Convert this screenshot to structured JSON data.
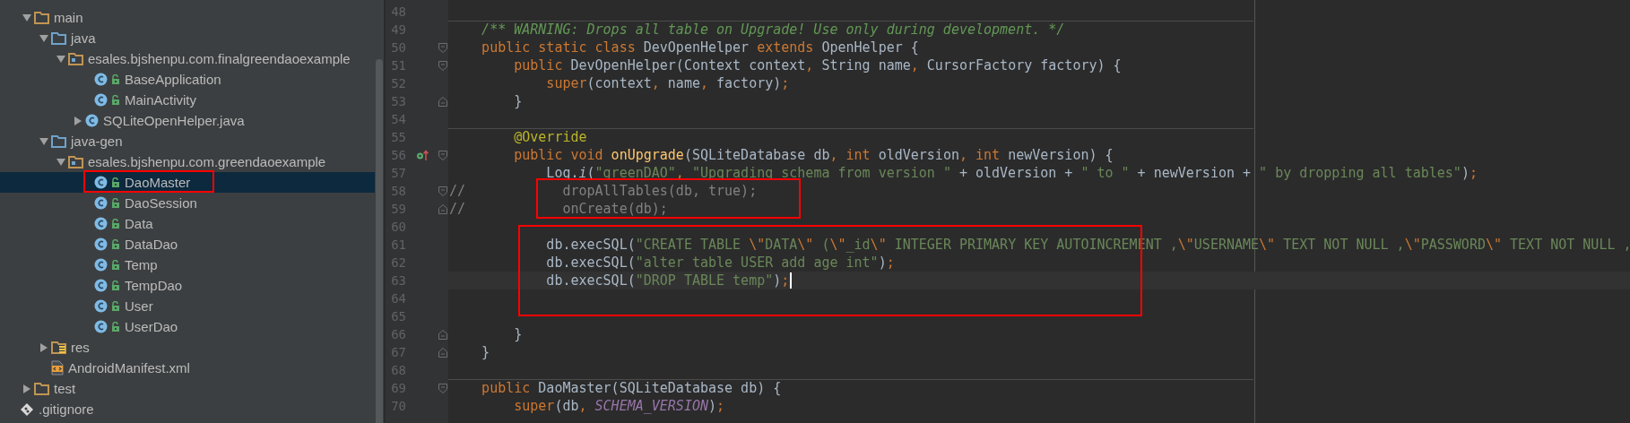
{
  "project_tree": [
    {
      "label": "main",
      "kind": "folder",
      "expanded": true,
      "selected": false,
      "children": [
        {
          "label": "java",
          "kind": "source-folder",
          "expanded": true,
          "selected": false,
          "children": [
            {
              "label": "esales.bjshenpu.com.finalgreendaoexample",
              "kind": "package",
              "expanded": true,
              "selected": false,
              "children": [
                {
                  "label": "BaseApplication",
                  "kind": "class",
                  "selected": false
                },
                {
                  "label": "MainActivity",
                  "kind": "class",
                  "selected": false
                },
                {
                  "label": "SQLiteOpenHelper.java",
                  "kind": "java-file",
                  "expanded": false,
                  "selected": false
                }
              ]
            }
          ]
        },
        {
          "label": "java-gen",
          "kind": "source-folder",
          "expanded": true,
          "selected": false,
          "children": [
            {
              "label": "esales.bjshenpu.com.greendaoexample",
              "kind": "package",
              "expanded": true,
              "selected": false,
              "children": [
                {
                  "label": "DaoMaster",
                  "kind": "class",
                  "selected": true
                },
                {
                  "label": "DaoSession",
                  "kind": "class",
                  "selected": false
                },
                {
                  "label": "Data",
                  "kind": "class",
                  "selected": false
                },
                {
                  "label": "DataDao",
                  "kind": "class",
                  "selected": false
                },
                {
                  "label": "Temp",
                  "kind": "class",
                  "selected": false
                },
                {
                  "label": "TempDao",
                  "kind": "class",
                  "selected": false
                },
                {
                  "label": "User",
                  "kind": "class",
                  "selected": false
                },
                {
                  "label": "UserDao",
                  "kind": "class",
                  "selected": false
                }
              ]
            }
          ]
        },
        {
          "label": "res",
          "kind": "res-folder",
          "expanded": false,
          "selected": false
        },
        {
          "label": "AndroidManifest.xml",
          "kind": "manifest",
          "selected": false
        }
      ]
    },
    {
      "label": "test",
      "kind": "folder",
      "expanded": false,
      "selected": false
    },
    {
      "label": ".gitignore",
      "kind": "git-file",
      "selected": false
    }
  ],
  "editor": {
    "lines": [
      {
        "number": "48",
        "fold_start": false,
        "fold_end": false,
        "override": false,
        "separator_above": false,
        "current": false
      },
      {
        "number": "49",
        "fold_start": false,
        "fold_end": false,
        "override": false,
        "separator_above": true,
        "current": false,
        "tokens": [
          {
            "kind": "doc",
            "text": "    /** WARNING: Drops all table on Upgrade! Use only during development. */"
          }
        ]
      },
      {
        "number": "50",
        "fold_start": true,
        "fold_end": false,
        "override": false,
        "separator_above": false,
        "current": false,
        "tokens": [
          {
            "kind": "keyword",
            "text": "    public static class "
          },
          {
            "kind": "plain",
            "text": "DevOpenHelper "
          },
          {
            "kind": "keyword",
            "text": "extends "
          },
          {
            "kind": "plain",
            "text": "OpenHelper {"
          }
        ]
      },
      {
        "number": "51",
        "fold_start": true,
        "fold_end": false,
        "override": false,
        "separator_above": false,
        "current": false,
        "tokens": [
          {
            "kind": "keyword",
            "text": "        public "
          },
          {
            "kind": "plain",
            "text": "DevOpenHelper(Context context"
          },
          {
            "kind": "punct",
            "text": ", "
          },
          {
            "kind": "plain",
            "text": "String name"
          },
          {
            "kind": "punct",
            "text": ", "
          },
          {
            "kind": "plain",
            "text": "CursorFactory factory) {"
          }
        ]
      },
      {
        "number": "52",
        "fold_start": false,
        "fold_end": false,
        "override": false,
        "separator_above": false,
        "current": false,
        "tokens": [
          {
            "kind": "keyword",
            "text": "            super"
          },
          {
            "kind": "plain",
            "text": "(context"
          },
          {
            "kind": "punct",
            "text": ", "
          },
          {
            "kind": "plain",
            "text": "name"
          },
          {
            "kind": "punct",
            "text": ", "
          },
          {
            "kind": "plain",
            "text": "factory)"
          },
          {
            "kind": "punct",
            "text": ";"
          }
        ]
      },
      {
        "number": "53",
        "fold_start": false,
        "fold_end": true,
        "override": false,
        "separator_above": false,
        "current": false,
        "tokens": [
          {
            "kind": "plain",
            "text": "        }"
          }
        ]
      },
      {
        "number": "54",
        "fold_start": false,
        "fold_end": false,
        "override": false,
        "separator_above": false,
        "current": false
      },
      {
        "number": "55",
        "fold_start": false,
        "fold_end": false,
        "override": false,
        "separator_above": true,
        "current": false,
        "tokens": [
          {
            "kind": "annotation",
            "text": "        @Override"
          }
        ]
      },
      {
        "number": "56",
        "fold_start": true,
        "fold_end": false,
        "override": true,
        "separator_above": false,
        "current": false,
        "tokens": [
          {
            "kind": "keyword",
            "text": "        public void "
          },
          {
            "kind": "method",
            "text": "onUpgrade"
          },
          {
            "kind": "plain",
            "text": "(SQLiteDatabase db"
          },
          {
            "kind": "punct",
            "text": ", "
          },
          {
            "kind": "keyword",
            "text": "int "
          },
          {
            "kind": "plain",
            "text": "oldVersion"
          },
          {
            "kind": "punct",
            "text": ", "
          },
          {
            "kind": "keyword",
            "text": "int "
          },
          {
            "kind": "plain",
            "text": "newVersion) {"
          }
        ]
      },
      {
        "number": "57",
        "fold_start": false,
        "fold_end": false,
        "override": false,
        "separator_above": false,
        "current": false,
        "tokens": [
          {
            "kind": "plain",
            "text": "            Log."
          },
          {
            "kind": "static",
            "text": "i"
          },
          {
            "kind": "plain",
            "text": "("
          },
          {
            "kind": "string",
            "text": "\"greenDAO\""
          },
          {
            "kind": "punct",
            "text": ", "
          },
          {
            "kind": "string",
            "text": "\"Upgrading schema from version \""
          },
          {
            "kind": "plain",
            "text": " + oldVersion + "
          },
          {
            "kind": "string",
            "text": "\" to \""
          },
          {
            "kind": "plain",
            "text": " + newVersion + "
          },
          {
            "kind": "string",
            "text": "\" by dropping all tables\""
          },
          {
            "kind": "plain",
            "text": ")"
          },
          {
            "kind": "punct",
            "text": ";"
          }
        ]
      },
      {
        "number": "58",
        "fold_start": true,
        "fold_end": false,
        "override": false,
        "separator_above": false,
        "current": false,
        "tokens": [
          {
            "kind": "commented",
            "text": "//            dropAllTables(db, true);"
          }
        ]
      },
      {
        "number": "59",
        "fold_start": false,
        "fold_end": true,
        "override": false,
        "separator_above": false,
        "current": false,
        "tokens": [
          {
            "kind": "commented",
            "text": "//            onCreate(db);"
          }
        ]
      },
      {
        "number": "60",
        "fold_start": false,
        "fold_end": false,
        "override": false,
        "separator_above": false,
        "current": false
      },
      {
        "number": "61",
        "fold_start": false,
        "fold_end": false,
        "override": false,
        "separator_above": false,
        "current": false,
        "tokens": [
          {
            "kind": "plain",
            "text": "            db.execSQL("
          },
          {
            "kind": "string",
            "text": "\"CREATE TABLE "
          },
          {
            "kind": "escape",
            "text": "\\\""
          },
          {
            "kind": "string",
            "text": "DATA"
          },
          {
            "kind": "escape",
            "text": "\\\""
          },
          {
            "kind": "string",
            "text": " ("
          },
          {
            "kind": "escape",
            "text": "\\\""
          },
          {
            "kind": "string",
            "text": "_id"
          },
          {
            "kind": "escape",
            "text": "\\\""
          },
          {
            "kind": "string",
            "text": " INTEGER PRIMARY KEY AUTOINCREMENT ,"
          },
          {
            "kind": "escape",
            "text": "\\\""
          },
          {
            "kind": "string",
            "text": "USERNAME"
          },
          {
            "kind": "escape",
            "text": "\\\""
          },
          {
            "kind": "string",
            "text": " TEXT NOT NULL ,"
          },
          {
            "kind": "escape",
            "text": "\\\""
          },
          {
            "kind": "string",
            "text": "PASSWORD"
          },
          {
            "kind": "escape",
            "text": "\\\""
          },
          {
            "kind": "string",
            "text": " TEXT NOT NULL ,"
          }
        ]
      },
      {
        "number": "62",
        "fold_start": false,
        "fold_end": false,
        "override": false,
        "separator_above": false,
        "current": false,
        "tokens": [
          {
            "kind": "plain",
            "text": "            db.execSQL("
          },
          {
            "kind": "string",
            "text": "\"alter table USER add age int\""
          },
          {
            "kind": "plain",
            "text": ")"
          },
          {
            "kind": "punct",
            "text": ";"
          }
        ]
      },
      {
        "number": "63",
        "fold_start": false,
        "fold_end": false,
        "override": false,
        "separator_above": false,
        "current": true,
        "tokens": [
          {
            "kind": "plain",
            "text": "            db.execSQL("
          },
          {
            "kind": "string",
            "text": "\"DROP TABLE temp\""
          },
          {
            "kind": "plain",
            "text": ")"
          },
          {
            "kind": "punct",
            "text": ";"
          }
        ]
      },
      {
        "number": "64",
        "fold_start": false,
        "fold_end": false,
        "override": false,
        "separator_above": false,
        "current": false
      },
      {
        "number": "65",
        "fold_start": false,
        "fold_end": false,
        "override": false,
        "separator_above": false,
        "current": false
      },
      {
        "number": "66",
        "fold_start": false,
        "fold_end": true,
        "override": false,
        "separator_above": false,
        "current": false,
        "tokens": [
          {
            "kind": "plain",
            "text": "        }"
          }
        ]
      },
      {
        "number": "67",
        "fold_start": false,
        "fold_end": true,
        "override": false,
        "separator_above": false,
        "current": false,
        "tokens": [
          {
            "kind": "plain",
            "text": "    }"
          }
        ]
      },
      {
        "number": "68",
        "fold_start": false,
        "fold_end": false,
        "override": false,
        "separator_above": false,
        "current": false
      },
      {
        "number": "69",
        "fold_start": true,
        "fold_end": false,
        "override": false,
        "separator_above": true,
        "current": false,
        "tokens": [
          {
            "kind": "keyword",
            "text": "    public "
          },
          {
            "kind": "plain",
            "text": "DaoMaster(SQLiteDatabase db) {"
          }
        ]
      },
      {
        "number": "70",
        "fold_start": false,
        "fold_end": false,
        "override": false,
        "separator_above": false,
        "current": false,
        "tokens": [
          {
            "kind": "keyword",
            "text": "        super"
          },
          {
            "kind": "plain",
            "text": "(db"
          },
          {
            "kind": "punct",
            "text": ", "
          },
          {
            "kind": "constant",
            "text": "SCHEMA_VERSION"
          },
          {
            "kind": "plain",
            "text": ")"
          },
          {
            "kind": "punct",
            "text": ";"
          }
        ]
      }
    ]
  }
}
